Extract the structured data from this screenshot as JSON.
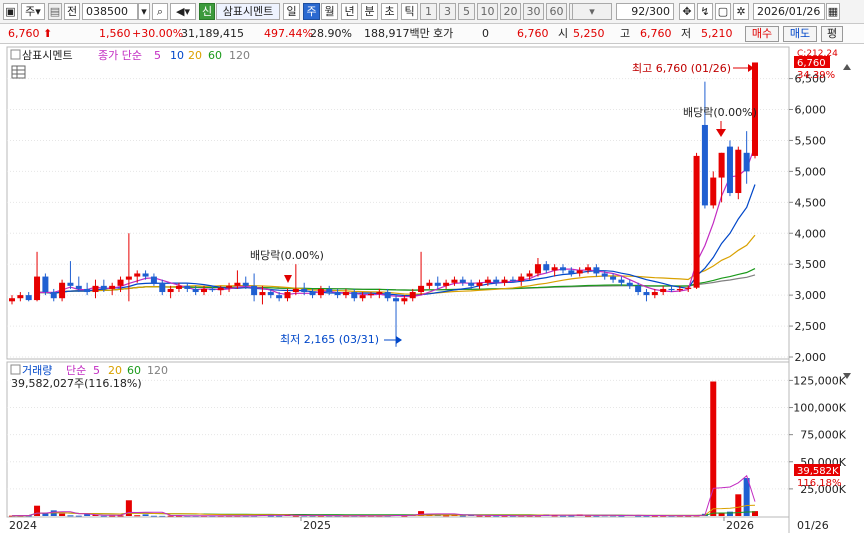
{
  "toolbar": {
    "period_unit": "주",
    "prev_label": "전",
    "code": "038500",
    "stock_name": "삼표시멘트",
    "period_buttons": [
      "일",
      "주",
      "월",
      "년",
      "분",
      "초",
      "틱"
    ],
    "interval_buttons": [
      "1",
      "3",
      "5",
      "10",
      "20",
      "30",
      "60",
      "120"
    ],
    "count": "92",
    "count_total": "/300",
    "date": "2026/01/26",
    "green_icon": "신"
  },
  "info": {
    "price": "6,760",
    "change": "1,560",
    "change_pct": "+30.00%",
    "volume": "31,189,415",
    "volume_ratio": "497.44%",
    "turnover": "28.90%",
    "amount": "188,917백만",
    "quote_label": "호가",
    "quote_value": "0",
    "quote_price": "6,760",
    "open_label": "시",
    "open": "5,250",
    "high_label": "고",
    "high": "6,760",
    "low_label": "저",
    "low": "5,210",
    "buy_label": "매수",
    "sell_label": "매도",
    "eval_label": "평"
  },
  "price_panel": {
    "stock_label": "삼표시멘트",
    "legend_main": "종가 단순",
    "ma_periods": [
      "5",
      "10",
      "20",
      "60",
      "120"
    ],
    "ma_colors": [
      "#c22bc2",
      "#0047c9",
      "#d9a100",
      "#1a9a1a",
      "#808080"
    ],
    "high_annotation": "최고 6,760 (01/26)",
    "low_annotation": "최저 2,165 (03/31)",
    "dividend_label_1": "배당락(0.00%)",
    "dividend_label_2": "배당락(0.00%)",
    "current_tag": "6,760",
    "current_pct": "34.39%",
    "top_tag": "C:212.24",
    "y_axis": [
      "6,500",
      "6,000",
      "5,500",
      "5,000",
      "4,500",
      "4,000",
      "3,500",
      "3,000",
      "2,500",
      "2,000"
    ]
  },
  "volume_panel": {
    "label": "거래량",
    "legend_main": "단순",
    "ma_periods": [
      "5",
      "20",
      "60",
      "120"
    ],
    "ma_colors": [
      "#c22bc2",
      "#d9a100",
      "#1a9a1a",
      "#808080"
    ],
    "current_value": "39,582,027주(116.18%)",
    "current_tag": "39,582K",
    "current_pct": "116.18%",
    "y_axis": [
      "125,000K",
      "100,000K",
      "75,000K",
      "50,000K",
      "25,000K"
    ]
  },
  "x_axis": [
    "2024",
    "2025",
    "2026",
    "01/26"
  ],
  "colors": {
    "up": "#e60000",
    "down": "#1f5fd1",
    "accent": "#2b6ad1"
  },
  "chart_data": {
    "type": "candlestick",
    "period": "weekly",
    "candles": [
      {
        "o": 2900,
        "h": 3000,
        "l": 2850,
        "c": 2950
      },
      {
        "o": 2950,
        "h": 3050,
        "l": 2900,
        "c": 3000
      },
      {
        "o": 3000,
        "h": 3050,
        "l": 2900,
        "c": 2920
      },
      {
        "o": 2920,
        "h": 3700,
        "l": 2900,
        "c": 3300
      },
      {
        "o": 3300,
        "h": 3350,
        "l": 3000,
        "c": 3050
      },
      {
        "o": 3050,
        "h": 3100,
        "l": 2900,
        "c": 2950
      },
      {
        "o": 2950,
        "h": 3250,
        "l": 2900,
        "c": 3200
      },
      {
        "o": 3200,
        "h": 3550,
        "l": 3100,
        "c": 3150
      },
      {
        "o": 3150,
        "h": 3300,
        "l": 3050,
        "c": 3100
      },
      {
        "o": 3100,
        "h": 3200,
        "l": 3000,
        "c": 3050
      },
      {
        "o": 3050,
        "h": 3250,
        "l": 2950,
        "c": 3150
      },
      {
        "o": 3150,
        "h": 3250,
        "l": 3050,
        "c": 3100
      },
      {
        "o": 3100,
        "h": 3200,
        "l": 3000,
        "c": 3150
      },
      {
        "o": 3150,
        "h": 3300,
        "l": 3050,
        "c": 3250
      },
      {
        "o": 3250,
        "h": 4000,
        "l": 2900,
        "c": 3300
      },
      {
        "o": 3300,
        "h": 3400,
        "l": 3200,
        "c": 3350
      },
      {
        "o": 3350,
        "h": 3400,
        "l": 3250,
        "c": 3300
      },
      {
        "o": 3300,
        "h": 3350,
        "l": 3150,
        "c": 3200
      },
      {
        "o": 3200,
        "h": 3250,
        "l": 3000,
        "c": 3050
      },
      {
        "o": 3050,
        "h": 3150,
        "l": 2950,
        "c": 3100
      },
      {
        "o": 3100,
        "h": 3200,
        "l": 3050,
        "c": 3150
      },
      {
        "o": 3150,
        "h": 3200,
        "l": 3050,
        "c": 3100
      },
      {
        "o": 3100,
        "h": 3150,
        "l": 3000,
        "c": 3050
      },
      {
        "o": 3050,
        "h": 3150,
        "l": 3000,
        "c": 3100
      },
      {
        "o": 3100,
        "h": 3150,
        "l": 3050,
        "c": 3080
      },
      {
        "o": 3080,
        "h": 3150,
        "l": 3000,
        "c": 3120
      },
      {
        "o": 3120,
        "h": 3200,
        "l": 3050,
        "c": 3150
      },
      {
        "o": 3150,
        "h": 3400,
        "l": 3100,
        "c": 3200
      },
      {
        "o": 3200,
        "h": 3300,
        "l": 3100,
        "c": 3150
      },
      {
        "o": 3150,
        "h": 3350,
        "l": 2900,
        "c": 3000
      },
      {
        "o": 3000,
        "h": 3150,
        "l": 2850,
        "c": 3050
      },
      {
        "o": 3050,
        "h": 3100,
        "l": 2950,
        "c": 3000
      },
      {
        "o": 3000,
        "h": 3050,
        "l": 2900,
        "c": 2950
      },
      {
        "o": 2950,
        "h": 3100,
        "l": 2900,
        "c": 3050
      },
      {
        "o": 3050,
        "h": 3500,
        "l": 3000,
        "c": 3100
      },
      {
        "o": 3100,
        "h": 3200,
        "l": 3000,
        "c": 3050
      },
      {
        "o": 3050,
        "h": 3100,
        "l": 2950,
        "c": 3000
      },
      {
        "o": 3000,
        "h": 3150,
        "l": 2950,
        "c": 3100
      },
      {
        "o": 3100,
        "h": 3150,
        "l": 3000,
        "c": 3050
      },
      {
        "o": 3050,
        "h": 3100,
        "l": 2950,
        "c": 3000
      },
      {
        "o": 3000,
        "h": 3100,
        "l": 2950,
        "c": 3050
      },
      {
        "o": 3050,
        "h": 3100,
        "l": 2900,
        "c": 2950
      },
      {
        "o": 2950,
        "h": 3050,
        "l": 2900,
        "c": 3000
      },
      {
        "o": 3000,
        "h": 3050,
        "l": 2950,
        "c": 3020
      },
      {
        "o": 3020,
        "h": 3100,
        "l": 2950,
        "c": 3050
      },
      {
        "o": 3050,
        "h": 3100,
        "l": 2900,
        "c": 2950
      },
      {
        "o": 2950,
        "h": 3000,
        "l": 2165,
        "c": 2900
      },
      {
        "o": 2900,
        "h": 3000,
        "l": 2850,
        "c": 2950
      },
      {
        "o": 2950,
        "h": 3100,
        "l": 2900,
        "c": 3050
      },
      {
        "o": 3050,
        "h": 3700,
        "l": 3000,
        "c": 3150
      },
      {
        "o": 3150,
        "h": 3250,
        "l": 3100,
        "c": 3200
      },
      {
        "o": 3200,
        "h": 3300,
        "l": 3100,
        "c": 3150
      },
      {
        "o": 3150,
        "h": 3250,
        "l": 3100,
        "c": 3200
      },
      {
        "o": 3200,
        "h": 3300,
        "l": 3150,
        "c": 3250
      },
      {
        "o": 3250,
        "h": 3300,
        "l": 3150,
        "c": 3200
      },
      {
        "o": 3200,
        "h": 3250,
        "l": 3100,
        "c": 3150
      },
      {
        "o": 3150,
        "h": 3250,
        "l": 3100,
        "c": 3200
      },
      {
        "o": 3200,
        "h": 3300,
        "l": 3150,
        "c": 3250
      },
      {
        "o": 3250,
        "h": 3300,
        "l": 3150,
        "c": 3200
      },
      {
        "o": 3200,
        "h": 3300,
        "l": 3150,
        "c": 3250
      },
      {
        "o": 3250,
        "h": 3300,
        "l": 3200,
        "c": 3230
      },
      {
        "o": 3230,
        "h": 3350,
        "l": 3150,
        "c": 3300
      },
      {
        "o": 3300,
        "h": 3400,
        "l": 3250,
        "c": 3350
      },
      {
        "o": 3350,
        "h": 3600,
        "l": 3300,
        "c": 3500
      },
      {
        "o": 3500,
        "h": 3550,
        "l": 3350,
        "c": 3400
      },
      {
        "o": 3400,
        "h": 3500,
        "l": 3300,
        "c": 3450
      },
      {
        "o": 3450,
        "h": 3500,
        "l": 3350,
        "c": 3400
      },
      {
        "o": 3400,
        "h": 3450,
        "l": 3300,
        "c": 3350
      },
      {
        "o": 3350,
        "h": 3450,
        "l": 3300,
        "c": 3400
      },
      {
        "o": 3400,
        "h": 3500,
        "l": 3350,
        "c": 3450
      },
      {
        "o": 3450,
        "h": 3500,
        "l": 3300,
        "c": 3350
      },
      {
        "o": 3350,
        "h": 3400,
        "l": 3250,
        "c": 3300
      },
      {
        "o": 3300,
        "h": 3350,
        "l": 3200,
        "c": 3250
      },
      {
        "o": 3250,
        "h": 3300,
        "l": 3150,
        "c": 3200
      },
      {
        "o": 3200,
        "h": 3250,
        "l": 3100,
        "c": 3150
      },
      {
        "o": 3150,
        "h": 3200,
        "l": 3000,
        "c": 3050
      },
      {
        "o": 3050,
        "h": 3100,
        "l": 2900,
        "c": 3000
      },
      {
        "o": 3000,
        "h": 3100,
        "l": 2950,
        "c": 3050
      },
      {
        "o": 3050,
        "h": 3150,
        "l": 3000,
        "c": 3100
      },
      {
        "o": 3100,
        "h": 3150,
        "l": 3050,
        "c": 3080
      },
      {
        "o": 3080,
        "h": 3150,
        "l": 3050,
        "c": 3100
      },
      {
        "o": 3100,
        "h": 3150,
        "l": 3050,
        "c": 3120
      },
      {
        "o": 3120,
        "h": 5300,
        "l": 3100,
        "c": 5250
      },
      {
        "o": 5750,
        "h": 6450,
        "l": 4400,
        "c": 4450
      },
      {
        "o": 4450,
        "h": 5000,
        "l": 4400,
        "c": 4900
      },
      {
        "o": 4900,
        "h": 5300,
        "l": 4500,
        "c": 5300
      },
      {
        "o": 5400,
        "h": 5500,
        "l": 4600,
        "c": 4650
      },
      {
        "o": 4650,
        "h": 5400,
        "l": 4550,
        "c": 5350
      },
      {
        "o": 5300,
        "h": 5650,
        "l": 4800,
        "c": 5000
      },
      {
        "o": 5250,
        "h": 6760,
        "l": 5210,
        "c": 6760
      }
    ],
    "volume_k": [
      300,
      400,
      500,
      9500,
      2500,
      5200,
      2200,
      600,
      300,
      1800,
      1000,
      200,
      300,
      500,
      14500,
      700,
      1500,
      200,
      100,
      300,
      200,
      100,
      300,
      200,
      100,
      200,
      300,
      200,
      300,
      500,
      1200,
      400,
      200,
      1400,
      300,
      600,
      300,
      200,
      500,
      300,
      200,
      400,
      300,
      100,
      200,
      300,
      1400,
      500,
      1000,
      4500,
      2000,
      1500,
      600,
      900,
      400,
      1000,
      300,
      200,
      500,
      400,
      300,
      200,
      300,
      500,
      1500,
      600,
      200,
      400,
      1500,
      300,
      200,
      700,
      600,
      300,
      1000,
      400,
      200,
      300,
      500,
      200,
      500,
      400,
      600,
      2000,
      124000,
      3000,
      4000,
      20000,
      35000,
      4500,
      39582
    ],
    "price_ylim": [
      2000,
      6800
    ],
    "volume_ylim": [
      0,
      130000
    ]
  }
}
